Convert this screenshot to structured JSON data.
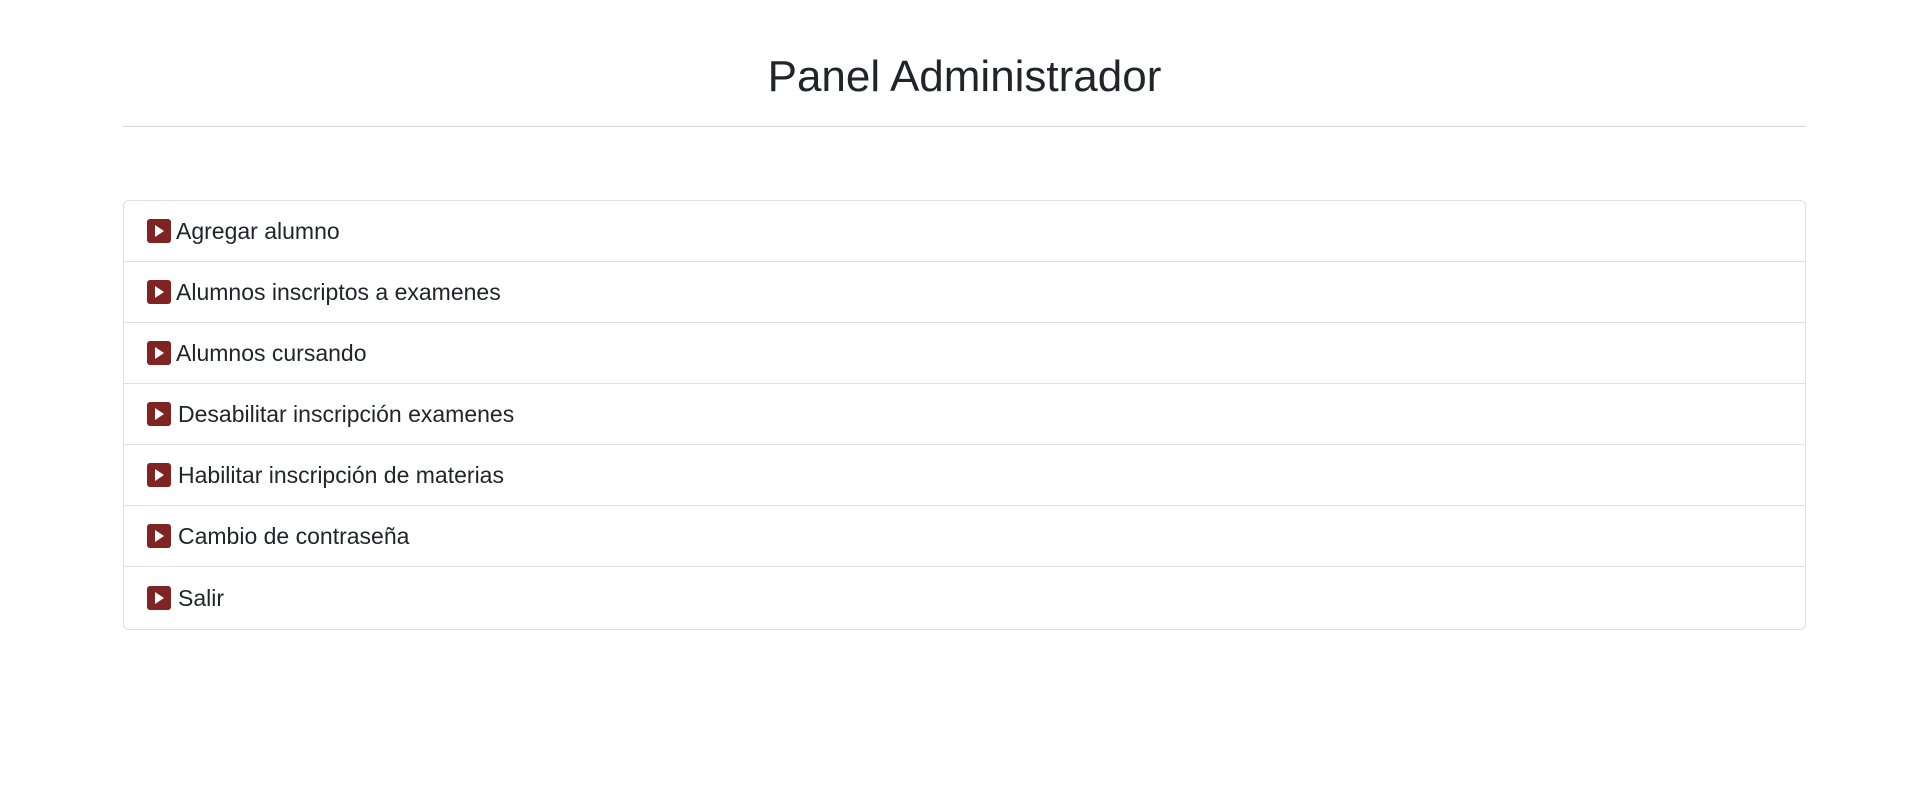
{
  "page": {
    "title": "Panel Administrador"
  },
  "menu": {
    "items": [
      {
        "label": "Agregar alumno",
        "icon": "play-icon"
      },
      {
        "label": "Alumnos inscriptos a examenes",
        "icon": "play-icon"
      },
      {
        "label": "Alumnos cursando",
        "icon": "play-icon"
      },
      {
        "label": "Desabilitar inscripción examenes",
        "icon": "play-icon"
      },
      {
        "label": "Habilitar inscripción de materias",
        "icon": "play-icon"
      },
      {
        "label": "Cambio de contraseña",
        "icon": "play-icon"
      },
      {
        "label": "Salir",
        "icon": "play-icon"
      }
    ]
  },
  "colors": {
    "icon_background": "#7f2323",
    "text": "#212529",
    "border": "#dfdfdf"
  }
}
